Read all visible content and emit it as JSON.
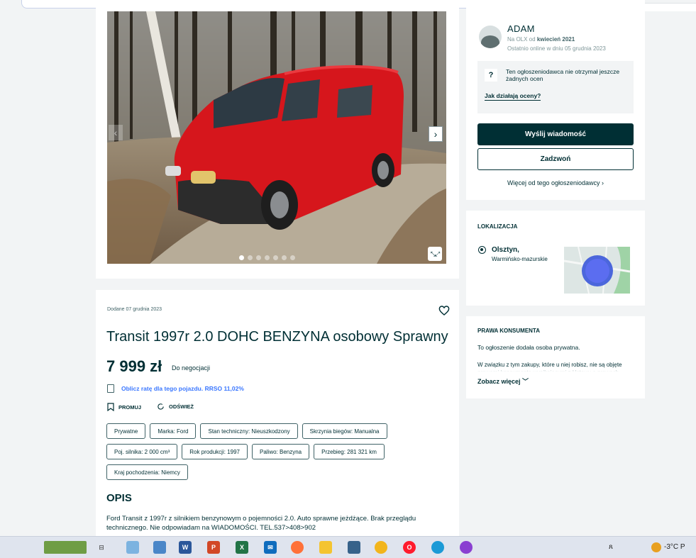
{
  "seller": {
    "name": "ADAM",
    "since_prefix": "Na OLX od ",
    "since_date": "kwiecień 2021",
    "last_online": "Ostatnio online w dniu 05 grudnia 2023",
    "rating_text": "Ten ogłoszeniodawca nie otrzymał jeszcze żadnych ocen",
    "rating_link": "Jak działają oceny?",
    "message_button": "Wyślij wiadomość",
    "call_button": "Zadzwoń",
    "more_link": "Więcej od tego ogłoszeniodawcy"
  },
  "location": {
    "heading": "LOKALIZACJA",
    "city": "Olsztyn,",
    "region": "Warmińsko-mazurskie"
  },
  "rights": {
    "heading": "PRAWA KONSUMENTA",
    "bold": "To ogłoszenie dodała osoba prywatna.",
    "text": "W związku z tym zakupy, które u niej robisz, nie są objęte prawami konsumenta wynikającymi z Ustawy o prawach konsumenta.",
    "see_more": "Zobacz więcej"
  },
  "ad": {
    "date": "Dodane 07 grudnia 2023",
    "title": "Transit 1997r 2.0 DOHC BENZYNA osobowy Sprawny",
    "price": "7 999 zł",
    "negotiable": "Do negocjacji",
    "calc_link": "Oblicz ratę dla tego pojazdu. RRSO 11,02%",
    "promote": "PROMUJ",
    "refresh": "ODŚWIEŻ",
    "tags": [
      "Prywatne",
      "Marka: Ford",
      "Stan techniczny: Nieuszkodzony",
      "Skrzynia biegów: Manualna",
      "Poj. silnika: 2 000 cm³",
      "Rok produkcji: 1997",
      "Paliwo: Benzyna",
      "Przebieg: 281 321 km",
      "Kraj pochodzenia: Niemcy"
    ],
    "desc_heading": "OPIS",
    "description": "Ford Transit z 1997r z silnikiem benzynowym o pojemności 2.0. Auto sprawne jeżdżące. Brak przeglądu technicznego. Nie odpowiadam na WIADOMOŚCI. TEL.537>408>902"
  },
  "gallery": {
    "image_count": 7,
    "active_index": 0
  },
  "taskbar": {
    "temperature": "-3°C",
    "weather_suffix": "P"
  }
}
